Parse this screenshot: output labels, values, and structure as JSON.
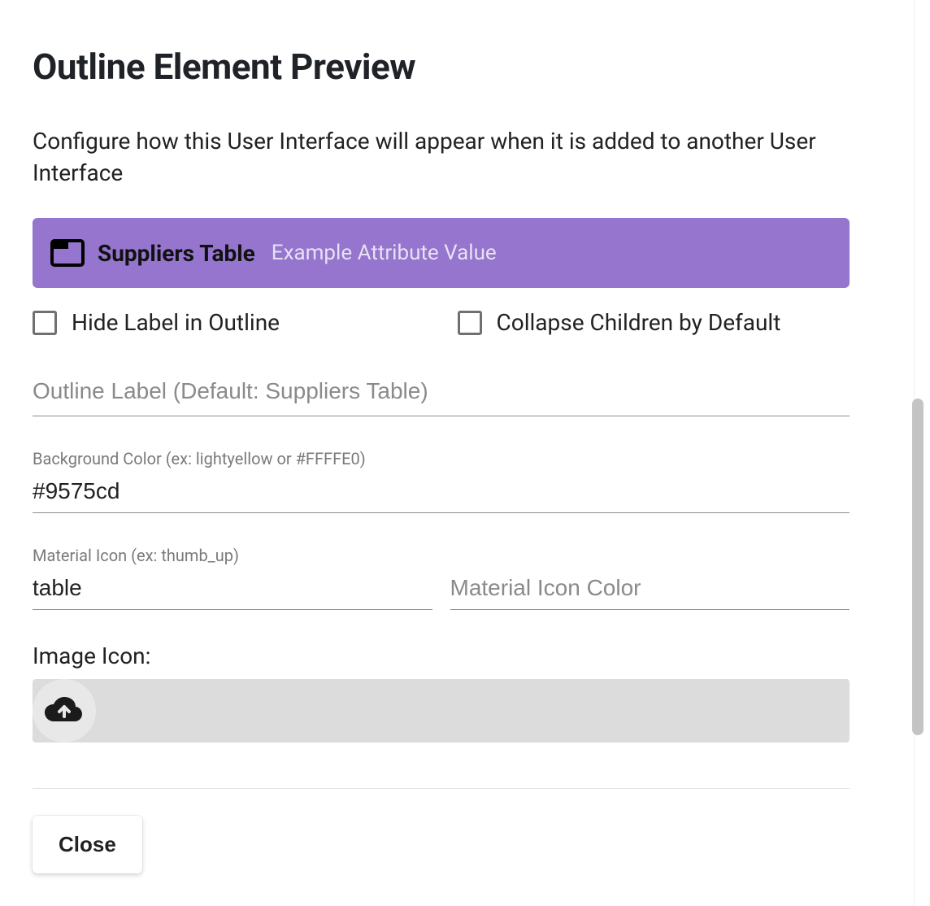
{
  "header": {
    "title": "Outline Element Preview"
  },
  "description": "Configure how this User Interface will appear when it is added to another User Interface",
  "preview": {
    "title": "Suppliers Table",
    "subtitle": "Example Attribute Value",
    "background_color": "#9575cd"
  },
  "checkboxes": {
    "hide_label": "Hide Label in Outline",
    "collapse_children": "Collapse Children by Default"
  },
  "fields": {
    "outline_label": {
      "placeholder": "Outline Label (Default: Suppliers Table)",
      "value": ""
    },
    "background_color": {
      "label": "Background Color (ex: lightyellow or #FFFFE0)",
      "value": "#9575cd"
    },
    "material_icon": {
      "label": "Material Icon (ex: thumb_up)",
      "value": "table"
    },
    "material_icon_color": {
      "placeholder": "Material Icon Color",
      "value": ""
    },
    "image_icon": {
      "label": "Image Icon:"
    }
  },
  "buttons": {
    "close": "Close"
  }
}
